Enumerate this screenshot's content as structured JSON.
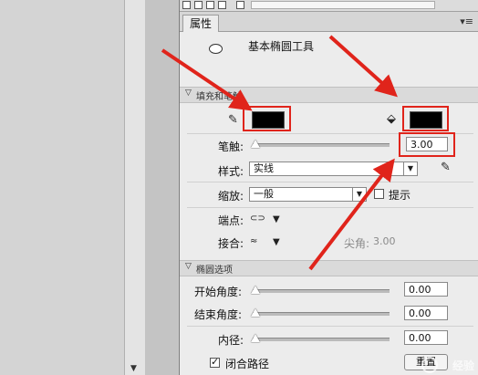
{
  "panel": {
    "tab_label": "属性",
    "tab_menu_glyph": "▾≡",
    "tool_name": "基本椭圆工具",
    "fill_stroke_section": "填充和笔触",
    "oval_section": "椭圆选项"
  },
  "stroke_fields": {
    "stroke_label": "笔触:",
    "stroke_value": "3.00",
    "style_label": "样式:",
    "style_value": "实线",
    "scale_label": "缩放:",
    "scale_value": "一般",
    "hint_label": "提示",
    "cap_label": "端点:",
    "join_label": "接合:",
    "miter_label": "尖角:",
    "miter_value": "3.00"
  },
  "oval_fields": {
    "start_angle_label": "开始角度:",
    "start_angle_value": "0.00",
    "end_angle_label": "结束角度:",
    "end_angle_value": "0.00",
    "inner_radius_label": "内径:",
    "inner_radius_value": "0.00",
    "close_path_label": "闭合路径",
    "close_path_checked": true,
    "reset_label": "重置"
  },
  "colors": {
    "stroke_color": "#000000",
    "fill_color": "#000000",
    "annotation_red": "#e0241b"
  },
  "watermark": "经验"
}
